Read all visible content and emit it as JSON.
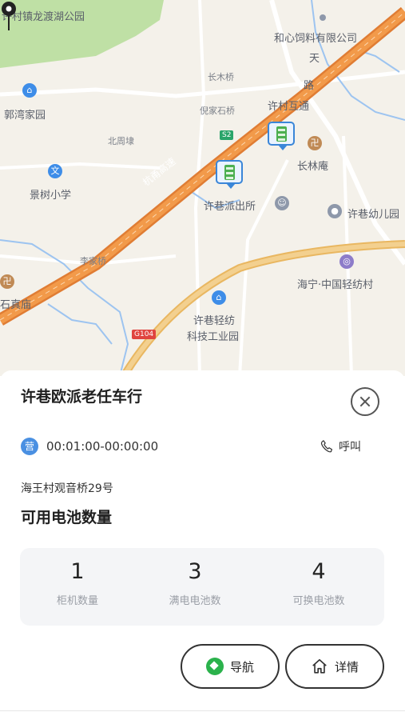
{
  "map": {
    "labels": {
      "park": "许村镇龙渡湖公园",
      "hexin": "和心饲料有限公司",
      "tian": "天",
      "lu": "路",
      "changmuqiao": "长木桥",
      "guowan": "郭湾家园",
      "nishi": "倪家石桥",
      "xucun_hutong": "许村互通",
      "beizhou": "北周埭",
      "changlin": "长林庵",
      "jingshu": "景树小学",
      "hangyong": "杭甬高速",
      "police": "许巷派出所",
      "kindergarten": "许巷幼儿园",
      "lijia": "李家桥",
      "haining": "海宁·中国轻纺村",
      "temple": "石真庙",
      "textile_1": "许巷轻纺",
      "textile_2": "科技工业园",
      "road_s2": "S2",
      "road_g104": "G104"
    },
    "colors": {
      "background": "#f4f1ea",
      "highway": "#f29a4a",
      "main_road": "#f3c97a",
      "park": "#bfe0a5",
      "water": "#9dc4f0"
    }
  },
  "panel": {
    "station_name": "许巷欧派老任车行",
    "close_icon": "close-icon",
    "hours_badge": "营",
    "hours": "00:01:00-00:00:00",
    "call_label": "呼叫",
    "address": "海王村观音桥29号",
    "available_title": "可用电池数量",
    "stats": [
      {
        "value": "1",
        "label": "柜机数量"
      },
      {
        "value": "3",
        "label": "满电电池数"
      },
      {
        "value": "4",
        "label": "可换电池数"
      }
    ],
    "nav_label": "导航",
    "detail_label": "详情"
  }
}
